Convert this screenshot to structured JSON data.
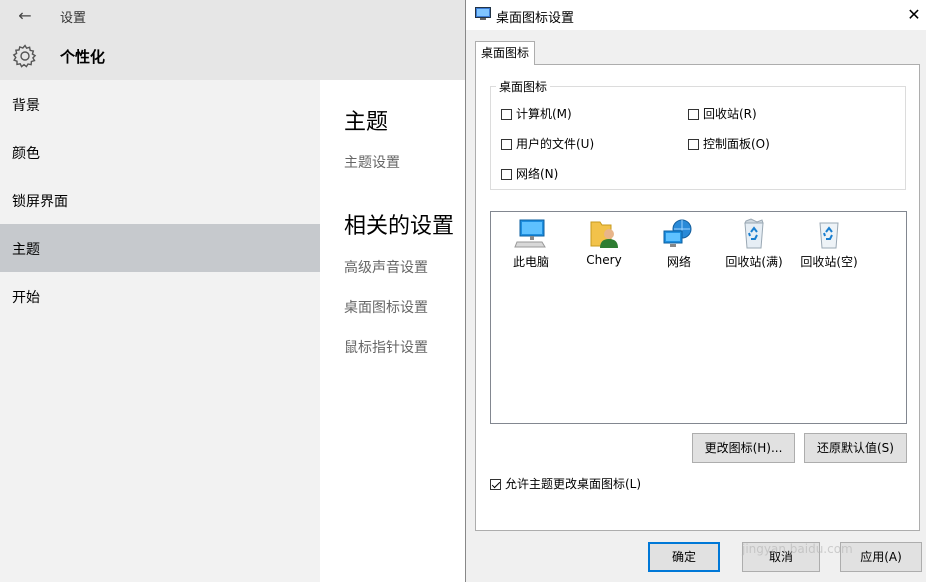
{
  "settings": {
    "app_title": "设置",
    "page_heading": "个性化",
    "sidebar": [
      {
        "label": "背景",
        "selected": false
      },
      {
        "label": "颜色",
        "selected": false
      },
      {
        "label": "锁屏界面",
        "selected": false
      },
      {
        "label": "主题",
        "selected": true
      },
      {
        "label": "开始",
        "selected": false
      }
    ],
    "content": {
      "theme_heading": "主题",
      "theme_settings_link": "主题设置",
      "related_heading": "相关的设置",
      "links": [
        "高级声音设置",
        "桌面图标设置",
        "鼠标指针设置"
      ]
    }
  },
  "dialog": {
    "title": "桌面图标设置",
    "tab_label": "桌面图标",
    "group_label": "桌面图标",
    "checkboxes": {
      "computer": {
        "label": "计算机(M)",
        "checked": false
      },
      "recycle_bin": {
        "label": "回收站(R)",
        "checked": false
      },
      "user_files": {
        "label": "用户的文件(U)",
        "checked": false
      },
      "control_panel": {
        "label": "控制面板(O)",
        "checked": false
      },
      "network": {
        "label": "网络(N)",
        "checked": false
      }
    },
    "icons": [
      {
        "label": "此电脑",
        "icon": "this-pc-icon"
      },
      {
        "label": "Chery",
        "icon": "user-folder-icon"
      },
      {
        "label": "网络",
        "icon": "network-icon"
      },
      {
        "label": "回收站(满)",
        "icon": "recycle-bin-full-icon"
      },
      {
        "label": "回收站(空)",
        "icon": "recycle-bin-empty-icon"
      }
    ],
    "change_icon_button": "更改图标(H)...",
    "restore_default_button": "还原默认值(S)",
    "allow_themes": {
      "label": "允许主题更改桌面图标(L)",
      "checked": true
    },
    "ok_button": "确定",
    "cancel_button": "取消",
    "apply_button": "应用(A)"
  },
  "watermark": {
    "logo_text": "Bai du 经验",
    "url": "jingyan.baidu.com"
  },
  "colors": {
    "accent": "#0078d7",
    "selected_nav": "#c6c9cd",
    "sidebar_bg": "#f2f2f2",
    "header_bg": "#e6e6e6",
    "dialog_bg": "#f0f0f0"
  }
}
